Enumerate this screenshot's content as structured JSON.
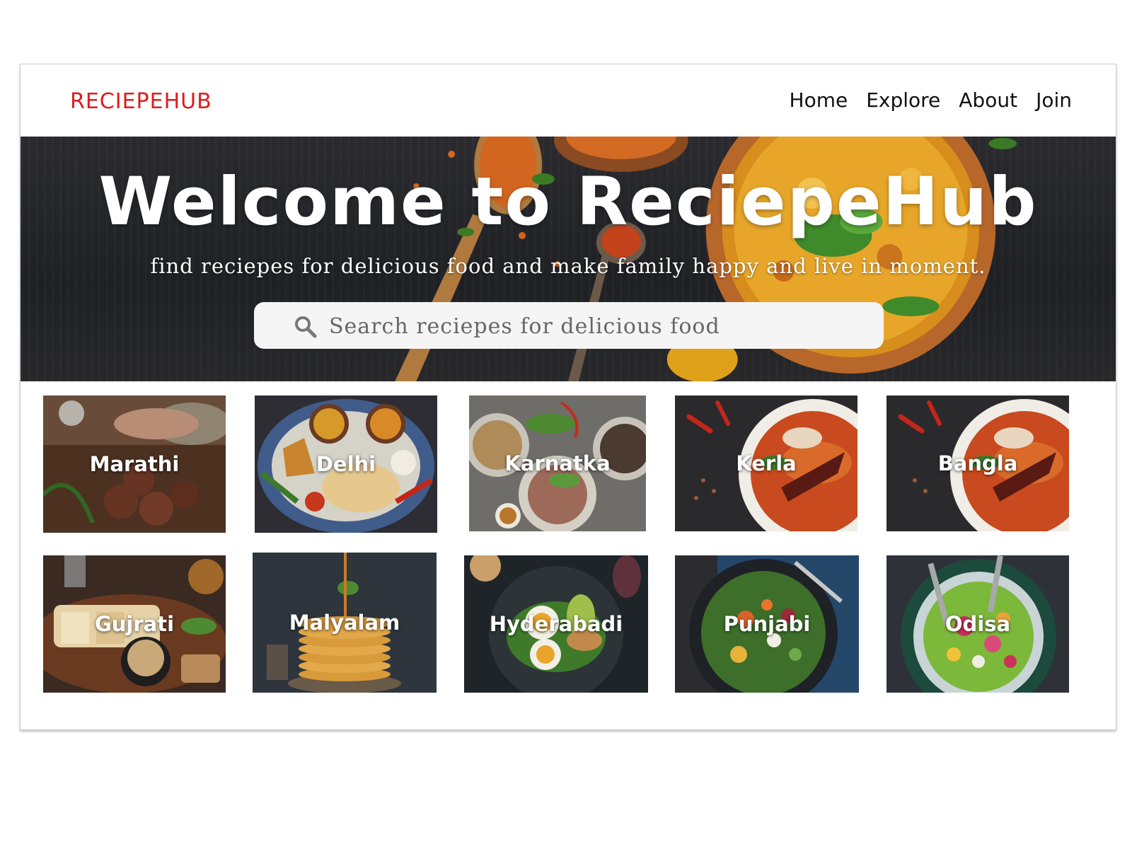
{
  "brand": {
    "name": "RECIEPEHUB"
  },
  "nav": {
    "items": [
      "Home",
      "Explore",
      "About",
      "Join"
    ]
  },
  "hero": {
    "title": "Welcome to ReciepeHub",
    "subtitle": "find reciepes for delicious food and make family happy and live in moment."
  },
  "search": {
    "placeholder": "Search reciepes for delicious food",
    "icon": "search-icon"
  },
  "categories": [
    {
      "label": "Marathi"
    },
    {
      "label": "Delhi"
    },
    {
      "label": "Karnatka"
    },
    {
      "label": "Kerla"
    },
    {
      "label": "Bangla"
    },
    {
      "label": "Gujrati"
    },
    {
      "label": "Malyalam"
    },
    {
      "label": "Hyderabadi"
    },
    {
      "label": "Punjabi"
    },
    {
      "label": "Odisa"
    }
  ],
  "colors": {
    "brand": "#e01b1b",
    "hero_bg": "#232428",
    "curry": "#d9961a"
  }
}
